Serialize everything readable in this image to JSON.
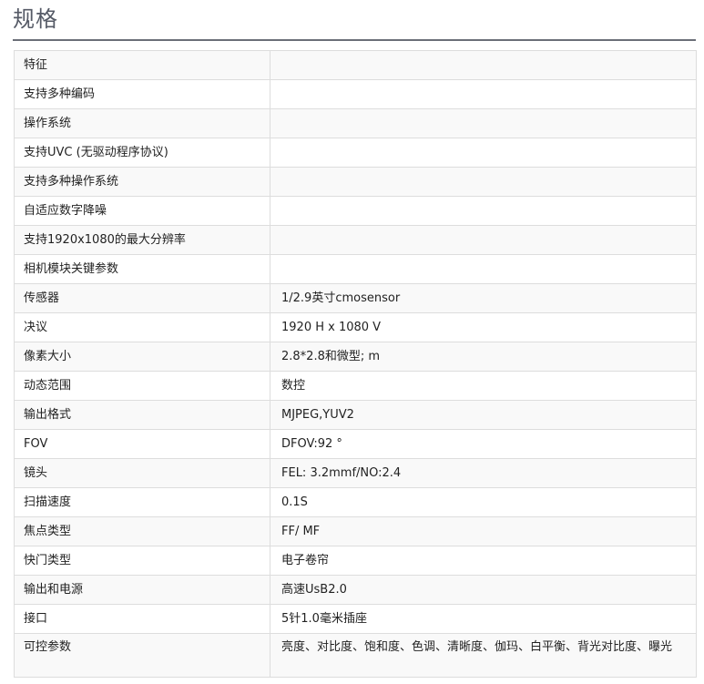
{
  "page": {
    "title": "规格"
  },
  "spec_table": {
    "rows": [
      {
        "feature": "特征",
        "value": ""
      },
      {
        "feature": "支持多种编码",
        "value": ""
      },
      {
        "feature": "操作系统",
        "value": ""
      },
      {
        "feature": "支持UVC (无驱动程序协议)",
        "value": ""
      },
      {
        "feature": "支持多种操作系统",
        "value": ""
      },
      {
        "feature": "自适应数字降噪",
        "value": ""
      },
      {
        "feature": "支持1920x1080的最大分辨率",
        "value": ""
      },
      {
        "feature": "相机模块关键参数",
        "value": ""
      },
      {
        "feature": "传感器",
        "value": "1/2.9英寸cmosensor"
      },
      {
        "feature": "决议",
        "value": "1920 H x 1080 V"
      },
      {
        "feature": "像素大小",
        "value": "2.8*2.8和微型; m"
      },
      {
        "feature": "动态范围",
        "value": "数控"
      },
      {
        "feature": "输出格式",
        "value": "MJPEG,YUV2"
      },
      {
        "feature": "FOV",
        "value": "DFOV:92 °"
      },
      {
        "feature": "镜头",
        "value": "FEL: 3.2mmf/NO:2.4"
      },
      {
        "feature": "扫描速度",
        "value": "0.1S"
      },
      {
        "feature": "焦点类型",
        "value": "FF/ MF"
      },
      {
        "feature": "快门类型",
        "value": "电子卷帘"
      },
      {
        "feature": "输出和电源",
        "value": "高速UsB2.0"
      },
      {
        "feature": "接口",
        "value": "5针1.0毫米插座"
      },
      {
        "feature": "可控参数",
        "value": "亮度、对比度、饱和度、色调、清晰度、伽玛、白平衡、背光对比度、曝光"
      }
    ]
  }
}
